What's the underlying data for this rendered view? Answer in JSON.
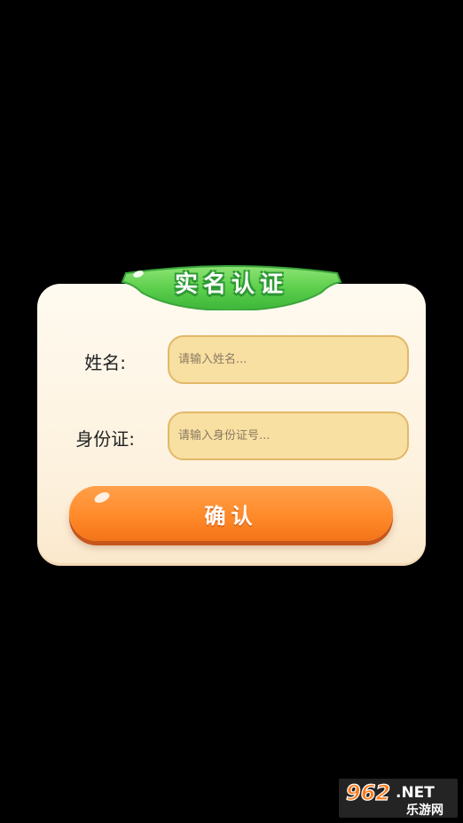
{
  "dialog": {
    "title": "实名认证",
    "fields": [
      {
        "label": "姓名:",
        "placeholder": "请输入姓名..."
      },
      {
        "label": "身份证:",
        "placeholder": "请输入身份证号..."
      }
    ],
    "confirm_label": "确认"
  },
  "watermark": {
    "brand_number": "962",
    "brand_suffix": ".NET",
    "brand_subtitle": "乐游网"
  },
  "colors": {
    "background": "#000000",
    "card": "#fdf3e1",
    "ribbon_green": "#5fd04f",
    "input_fill": "#f8dfa2",
    "input_border": "#e1b869",
    "button_orange": "#ff8a2a"
  },
  "icons": {
    "ribbon": "green-ribbon-banner",
    "button_highlight": "gloss-shine"
  }
}
